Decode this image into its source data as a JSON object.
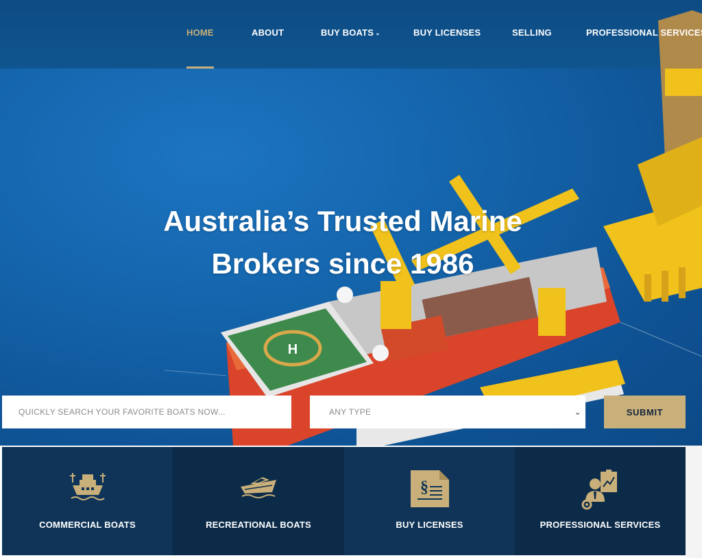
{
  "nav": {
    "items": [
      {
        "label": "HOME",
        "active": true
      },
      {
        "label": "ABOUT"
      },
      {
        "label": "BUY BOATS",
        "has_dropdown": true
      },
      {
        "label": "BUY LICENSES"
      },
      {
        "label": "SELLING"
      },
      {
        "label": "PROFESSIONAL SERVICES"
      }
    ],
    "dropdown_icon": "chevron-down-icon"
  },
  "hero": {
    "headline_line1": "Australia’s Trusted Marine",
    "headline_line2": "Brokers since 1986"
  },
  "search": {
    "placeholder": "QUICKLY SEARCH YOUR FAVORITE BOATS NOW...",
    "type_selected": "ANY TYPE",
    "submit_label": "SUBMIT"
  },
  "categories": [
    {
      "label": "COMMERCIAL BOATS",
      "icon": "commercial-boat-icon"
    },
    {
      "label": "RECREATIONAL BOATS",
      "icon": "speedboat-icon"
    },
    {
      "label": "BUY LICENSES",
      "icon": "license-document-icon"
    },
    {
      "label": "PROFESSIONAL SERVICES",
      "icon": "professional-services-icon"
    }
  ],
  "colors": {
    "accent_gold": "#c9b07a",
    "tile_dark": "#0f3457",
    "tile_darker": "#0b2b49",
    "ocean_blue": "#1566ad"
  }
}
